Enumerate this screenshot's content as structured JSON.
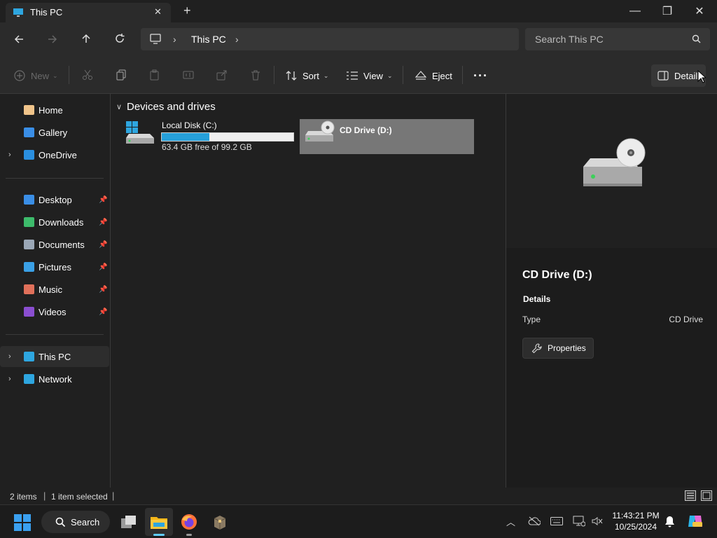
{
  "window": {
    "tab_title": "This PC",
    "new_tab_glyph": "+",
    "controls": {
      "minimize": "—",
      "maximize": "❐",
      "close": "✕"
    }
  },
  "navbar": {
    "breadcrumb": [
      "This PC"
    ],
    "search_placeholder": "Search This PC"
  },
  "commandbar": {
    "new_label": "New",
    "sort_label": "Sort",
    "view_label": "View",
    "eject_label": "Eject",
    "more_label": "···",
    "details_label": "Details"
  },
  "sidebar": {
    "quick": [
      {
        "label": "Home",
        "icon": "home-icon",
        "color": "#f0c48a"
      },
      {
        "label": "Gallery",
        "icon": "gallery-icon",
        "color": "#3a8ee6"
      },
      {
        "label": "OneDrive",
        "icon": "cloud-icon",
        "color": "#2a8fe0"
      }
    ],
    "pinned": [
      {
        "label": "Desktop",
        "icon": "desktop-icon",
        "color": "#3a8ee6"
      },
      {
        "label": "Downloads",
        "icon": "download-icon",
        "color": "#3dbb6b"
      },
      {
        "label": "Documents",
        "icon": "document-icon",
        "color": "#9aa7b6"
      },
      {
        "label": "Pictures",
        "icon": "picture-icon",
        "color": "#3aa0e6"
      },
      {
        "label": "Music",
        "icon": "music-icon",
        "color": "#e0705a"
      },
      {
        "label": "Videos",
        "icon": "video-icon",
        "color": "#8a4ed0"
      }
    ],
    "bottom": [
      {
        "label": "This PC",
        "icon": "computer-icon",
        "color": "#2ea6e0"
      },
      {
        "label": "Network",
        "icon": "network-icon",
        "color": "#2ea6e0"
      }
    ]
  },
  "content": {
    "group_label": "Devices and drives",
    "drives": [
      {
        "name": "Local Disk (C:)",
        "free_text": "63.4 GB free of 99.2 GB",
        "used_fraction": 0.36
      },
      {
        "name": "CD Drive (D:)"
      }
    ]
  },
  "details": {
    "title": "CD Drive (D:)",
    "section": "Details",
    "rows": [
      {
        "key": "Type",
        "value": "CD Drive"
      }
    ],
    "properties_label": "Properties"
  },
  "status": {
    "items": "2 items",
    "selected": "1 item selected"
  },
  "taskbar": {
    "search_label": "Search",
    "time": "11:43:21 PM",
    "date": "10/25/2024"
  },
  "colors": {
    "accent": "#26a0da",
    "selection": "#777777"
  }
}
